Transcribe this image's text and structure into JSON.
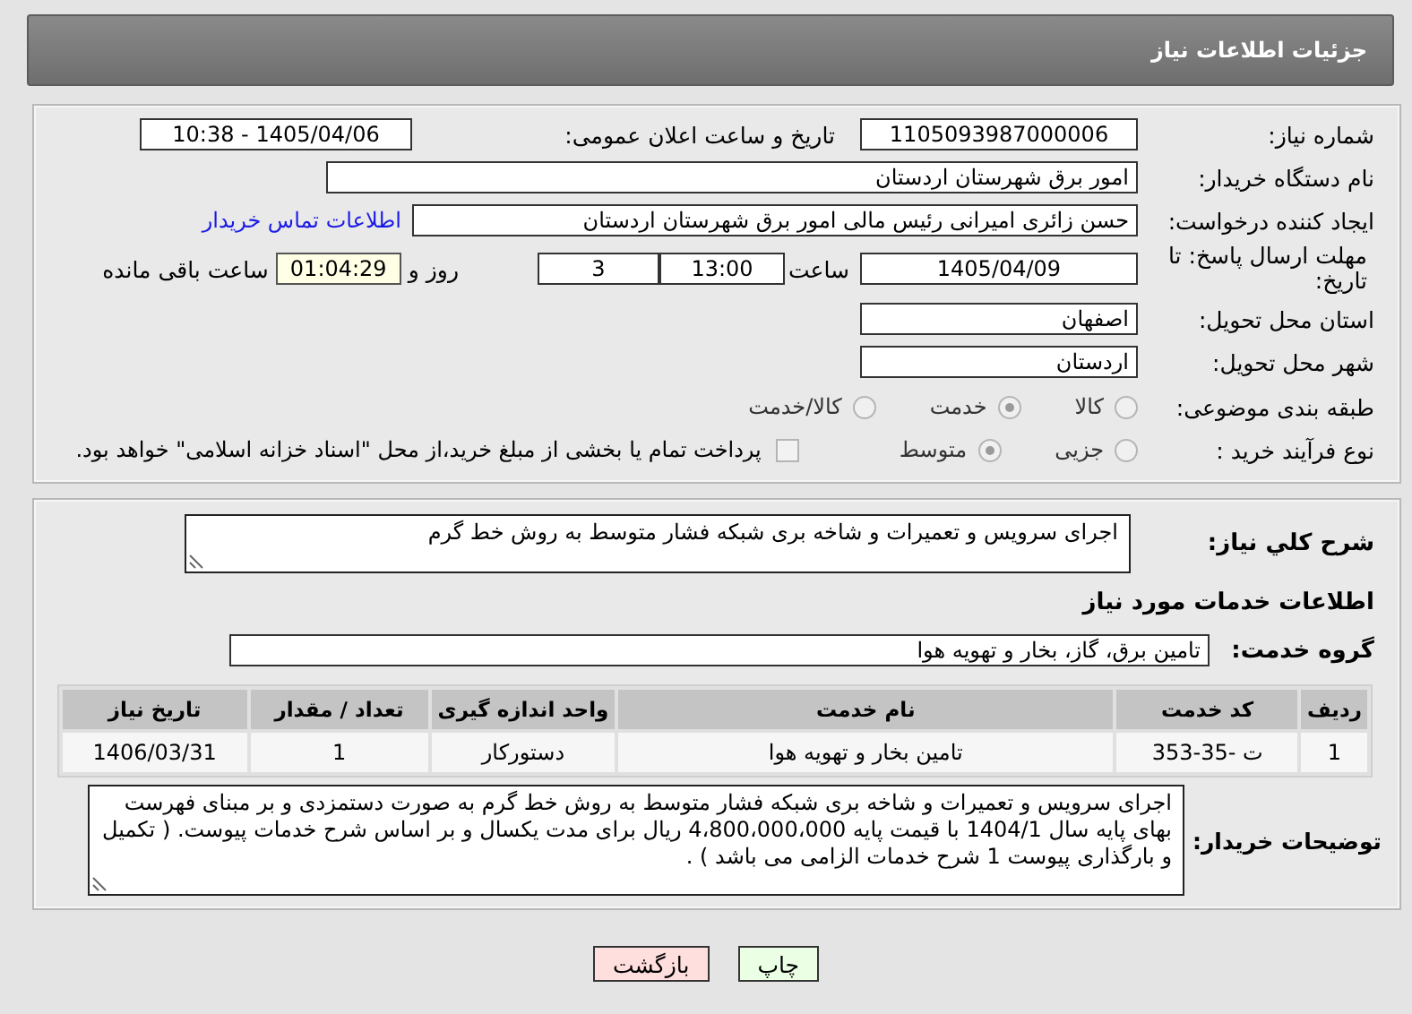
{
  "header": {
    "title": "جزئیات اطلاعات نیاز"
  },
  "need_number": {
    "label": "شماره نیاز:",
    "value": "1105093987000006"
  },
  "announce": {
    "label": "تاریخ و ساعت اعلان عمومی:",
    "value": "1405/04/06 - 10:38"
  },
  "buyer_org": {
    "label": "نام دستگاه خریدار:",
    "value": "امور برق شهرستان اردستان"
  },
  "requester": {
    "label": "ایجاد کننده درخواست:",
    "value": "حسن زائری امیرانی رئیس مالی امور برق شهرستان اردستان",
    "link": "اطلاعات تماس خریدار"
  },
  "deadline": {
    "label": "مهلت ارسال پاسخ: تا تاریخ:",
    "date": "1405/04/09",
    "time_label": "ساعت",
    "time": "13:00",
    "days": "3",
    "days_label": "روز و",
    "remaining": "01:04:29",
    "remaining_label": "ساعت باقی مانده"
  },
  "province": {
    "label": "استان محل تحویل:",
    "value": "اصفهان"
  },
  "city": {
    "label": "شهر محل تحویل:",
    "value": "اردستان"
  },
  "category": {
    "label": "طبقه بندی موضوعی:",
    "options": [
      {
        "label": "کالا",
        "selected": false
      },
      {
        "label": "خدمت",
        "selected": true
      },
      {
        "label": "کالا/خدمت",
        "selected": false
      }
    ]
  },
  "purchase_process": {
    "label": "نوع فرآیند خرید :",
    "options": [
      {
        "label": "جزیی",
        "selected": false
      },
      {
        "label": "متوسط",
        "selected": true
      }
    ],
    "payment": {
      "label": "پرداخت تمام یا بخشی از مبلغ خرید،از محل \"اسناد خزانه اسلامی\" خواهد بود.",
      "checked": false
    }
  },
  "description": {
    "label": "شرح کلي نياز:",
    "value": "اجرای سرویس و تعمیرات و شاخه بری شبکه فشار متوسط به روش خط گرم"
  },
  "services_heading": "اطلاعات خدمات مورد نیاز",
  "service_group": {
    "label": "گروه خدمت:",
    "value": "تامین برق، گاز، بخار و تهویه هوا"
  },
  "table": {
    "columns": [
      "ردیف",
      "کد خدمت",
      "نام خدمت",
      "واحد اندازه گیری",
      "تعداد / مقدار",
      "تاریخ نیاز"
    ],
    "rows": [
      [
        "1",
        "ت -35-353",
        "تامین بخار و تهویه هوا",
        "دستورکار",
        "1",
        "1406/03/31"
      ]
    ]
  },
  "buyer_notes": {
    "label": "توضیحات خریدار:",
    "value": "اجرای سرویس و تعمیرات و شاخه بری شبکه فشار متوسط  به روش خط گرم به صورت دستمزدی و بر مبنای فهرست بهای پایه سال 1404/1 با قیمت پایه 4،800،000،000 ریال برای مدت یکسال  و بر اساس شرح خدمات پیوست. ( تکمیل و بارگذاری پیوست 1 شرح خدمات الزامی می باشد ) ."
  },
  "buttons": [
    {
      "label": "چاپ",
      "kind": "print"
    },
    {
      "label": "بازگشت",
      "kind": "back"
    }
  ]
}
